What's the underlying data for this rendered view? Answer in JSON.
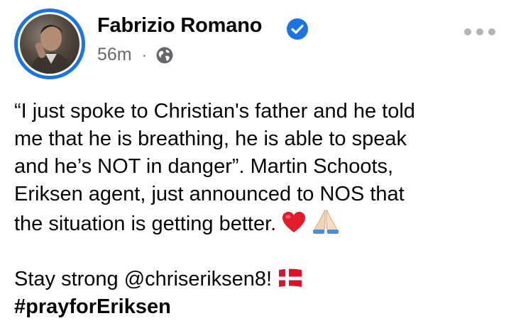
{
  "author": {
    "name": "Fabrizio Romano",
    "verified": true,
    "timestamp": "56m",
    "separator": "·",
    "audience_icon": "globe-icon"
  },
  "post": {
    "line1": "“I just spoke to Christian's father and he told",
    "line2": "me that he is breathing, he is able to speak",
    "line3": "and he’s NOT in danger”. Martin Schoots,",
    "line4": "Eriksen agent, just announced to NOS that",
    "line5": "the situation is getting better.",
    "line5_emojis": [
      "red-heart-emoji",
      "folded-hands-emoji"
    ],
    "line6": "Stay strong @chriseriksen8!",
    "line6_emoji": "denmark-flag-emoji",
    "hashtag": "#prayforEriksen"
  },
  "colors": {
    "accent": "#1b74e4",
    "text": "#050505",
    "secondary": "#65676b"
  }
}
